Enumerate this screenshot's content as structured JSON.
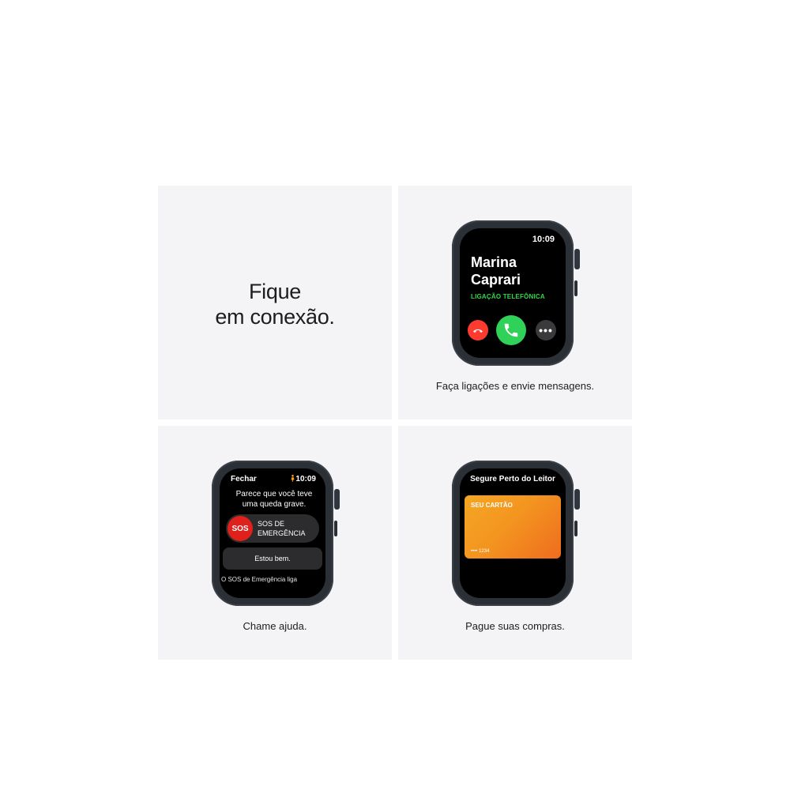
{
  "headline": {
    "line1": "Fique",
    "line2": "em conexão."
  },
  "call_tile": {
    "watch_time": "10:09",
    "caller_first": "Marina",
    "caller_last": "Caprari",
    "call_type": "LIGAÇÃO TELEFÔNICA",
    "more_glyph": "•••",
    "caption": "Faça ligações e envie mensagens."
  },
  "sos_tile": {
    "close_label": "Fechar",
    "watch_time": "10:09",
    "message_line1": "Parece que você teve",
    "message_line2": "uma queda grave.",
    "sos_badge": "SOS",
    "sos_label_line1": "SOS DE",
    "sos_label_line2": "EMERGÊNCIA",
    "ok_button": "Estou bem.",
    "footer_text": "O SOS de Emergência liga",
    "caption": "Chame ajuda."
  },
  "pay_tile": {
    "title": "Segure Perto do Leitor",
    "card_name": "SEU CARTÃO",
    "card_number": "•••• 1234",
    "caption": "Pague suas compras."
  },
  "colors": {
    "tile_bg": "#f4f4f6",
    "accept_green": "#30d158",
    "decline_red": "#ff3b30",
    "sos_red": "#e0201b",
    "card_orange": "#f39520"
  }
}
